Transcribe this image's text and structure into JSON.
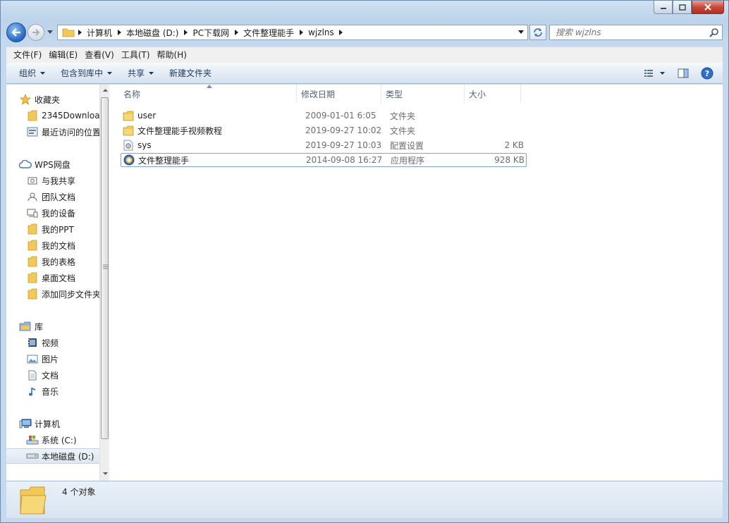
{
  "address": {
    "crumbs": [
      "计算机",
      "本地磁盘 (D:)",
      "PC下载网",
      "文件整理能手",
      "wjzlns"
    ]
  },
  "search": {
    "placeholder": "搜索 wjzlns"
  },
  "menubar": {
    "items": [
      "文件(F)",
      "编辑(E)",
      "查看(V)",
      "工具(T)",
      "帮助(H)"
    ]
  },
  "toolbar": {
    "organize": "组织",
    "include_library": "包含到库中",
    "share": "共享",
    "new_folder": "新建文件夹"
  },
  "nav": {
    "favorites": {
      "label": "收藏夹",
      "items": [
        "2345Downloa",
        "最近访问的位置"
      ]
    },
    "wps": {
      "label": "WPS网盘",
      "items": [
        "与我共享",
        "团队文档",
        "我的设备",
        "我的PPT",
        "我的文档",
        "我的表格",
        "桌面文档",
        "添加同步文件夹"
      ]
    },
    "library": {
      "label": "库",
      "items": [
        "视频",
        "图片",
        "文档",
        "音乐"
      ]
    },
    "computer": {
      "label": "计算机",
      "items": [
        "系统 (C:)",
        "本地磁盘 (D:)"
      ]
    }
  },
  "columns": {
    "name": "名称",
    "date": "修改日期",
    "type": "类型",
    "size": "大小"
  },
  "files": [
    {
      "name": "user",
      "date": "2009-01-01 6:05",
      "type": "文件夹",
      "size": "",
      "icon": "folder-icon"
    },
    {
      "name": "文件整理能手视频教程",
      "date": "2019-09-27 10:02",
      "type": "文件夹",
      "size": "",
      "icon": "folder-icon"
    },
    {
      "name": "sys",
      "date": "2019-09-27 10:03",
      "type": "配置设置",
      "size": "2 KB",
      "icon": "config-file-icon"
    },
    {
      "name": "文件整理能手",
      "date": "2014-09-08 16:27",
      "type": "应用程序",
      "size": "928 KB",
      "icon": "app-icon"
    }
  ],
  "status": {
    "count_text": "4 个对象"
  },
  "colors": {
    "accent": "#2b6cc4",
    "folder": "#f2c85b",
    "selection_border": "#7da2ce"
  }
}
